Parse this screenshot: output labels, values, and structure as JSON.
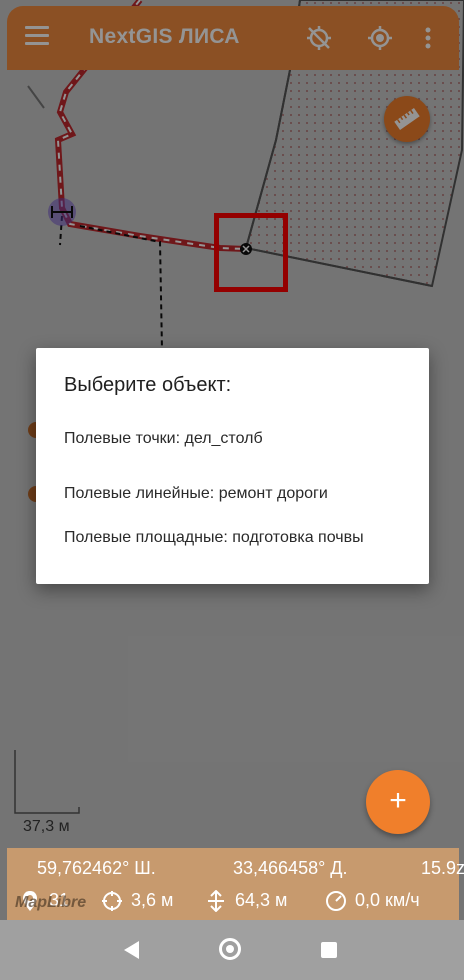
{
  "app_bar": {
    "title": "NextGIS ЛИСА",
    "menu_icon": "hamburger-menu-icon",
    "icons": [
      "gps-off-icon",
      "locate-icon",
      "more-vert-icon"
    ]
  },
  "map": {
    "ruler_icon": "ruler-icon",
    "scale_label": "37,3 м"
  },
  "dialog": {
    "title": "Выберите объект:",
    "options": [
      "Полевые точки: дел_столб",
      "Полевые линейные: ремонт дороги",
      "Полевые площадные: подготовка почвы"
    ]
  },
  "fab": {
    "label": "+"
  },
  "status": {
    "lat": "59,762462° Ш.",
    "lon": "33,466458° Д.",
    "zoom": "15.9z",
    "satellites": "31",
    "accuracy": "3,6 м",
    "altitude": "64,3 м",
    "speed": "0,0 км/ч",
    "attribution": "MapLibre"
  },
  "colors": {
    "accent": "#f08a3e",
    "highlight": "#ff0000",
    "track": "#c0282d"
  }
}
